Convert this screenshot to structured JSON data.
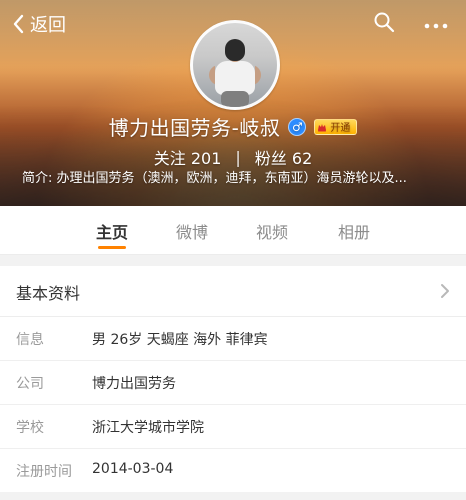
{
  "header": {
    "back_label": "返回",
    "icons": {
      "back": "chevron-left-icon",
      "search": "search-icon",
      "more": "more-horizontal-icon"
    }
  },
  "profile": {
    "name": "博力出国劳务-岐叔",
    "gender_icon": "male-icon",
    "gender_symbol": "♂",
    "vip_label": "开通",
    "following_label": "关注",
    "following_count": "201",
    "followers_label": "粉丝",
    "followers_count": "62",
    "bio": "简介: 办理出国劳务（澳洲，欧洲，迪拜，东南亚）海员游轮以及..."
  },
  "tabs": [
    {
      "label": "主页",
      "active": true
    },
    {
      "label": "微博",
      "active": false
    },
    {
      "label": "视频",
      "active": false
    },
    {
      "label": "相册",
      "active": false
    }
  ],
  "basic_info": {
    "title": "基本资料",
    "rows": [
      {
        "key": "信息",
        "value": "男  26岁  天蝎座  海外 菲律宾"
      },
      {
        "key": "公司",
        "value": "博力出国劳务"
      },
      {
        "key": "学校",
        "value": "浙江大学城市学院"
      },
      {
        "key": "注册时间",
        "value": "2014-03-04"
      }
    ]
  },
  "colors": {
    "accent_orange": "#ff8200",
    "male_blue": "#2b8cff",
    "vip_gold": "#ffb200"
  }
}
